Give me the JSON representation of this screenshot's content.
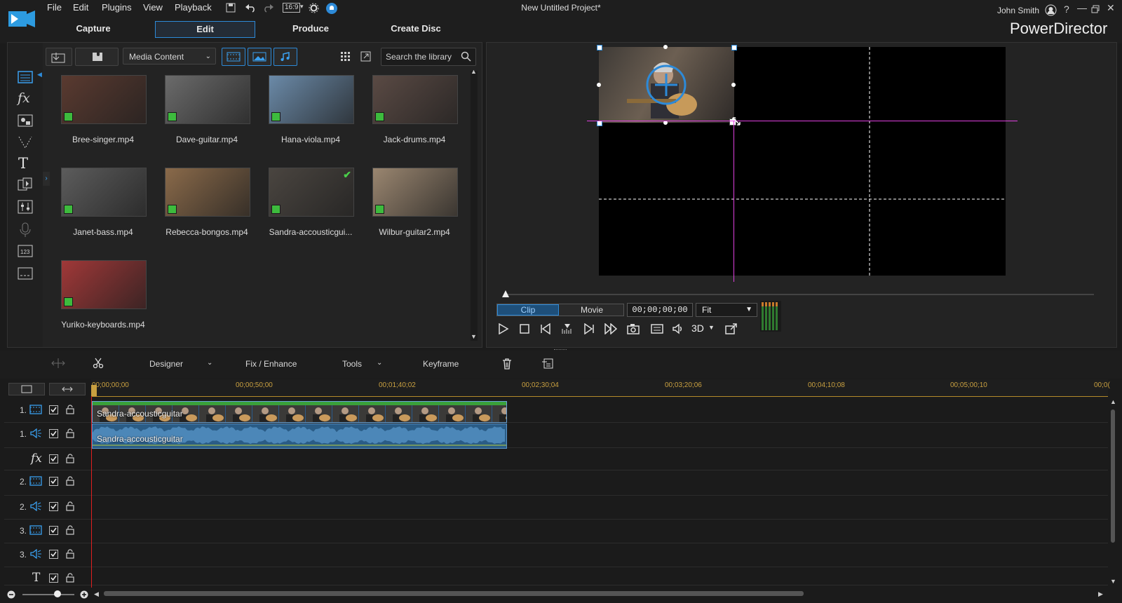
{
  "app": {
    "name": "PowerDirector",
    "project_title": "New Untitled Project*",
    "user": "John Smith",
    "aspect": "16:9"
  },
  "menu": [
    "File",
    "Edit",
    "Plugins",
    "View",
    "Playback"
  ],
  "mode_tabs": [
    "Capture",
    "Edit",
    "Produce",
    "Create Disc"
  ],
  "library": {
    "dropdown": "Media Content",
    "search_placeholder": "Search the library",
    "items": [
      {
        "name": "Bree-singer.mp4",
        "tone": "#5a3a30",
        "checked": false
      },
      {
        "name": "Dave-guitar.mp4",
        "tone": "#6b6b6b",
        "checked": false
      },
      {
        "name": "Hana-viola.mp4",
        "tone": "#6b8aa8",
        "checked": false
      },
      {
        "name": "Jack-drums.mp4",
        "tone": "#5a4a44",
        "checked": false
      },
      {
        "name": "Janet-bass.mp4",
        "tone": "#5c5c5c",
        "checked": false
      },
      {
        "name": "Rebecca-bongos.mp4",
        "tone": "#8a6a4a",
        "checked": false
      },
      {
        "name": "Sandra-accousticgui...",
        "tone": "#4a4540",
        "checked": true
      },
      {
        "name": "Wilbur-guitar2.mp4",
        "tone": "#9a8670",
        "checked": false
      },
      {
        "name": "Yuriko-keyboards.mp4",
        "tone": "#a03838",
        "checked": false
      }
    ]
  },
  "preview": {
    "clip_tab": "Clip",
    "movie_tab": "Movie",
    "timecode": "00;00;00;00",
    "fit": "Fit",
    "mode_3d": "3D"
  },
  "timeline_toolbar": {
    "designer": "Designer",
    "fix_enhance": "Fix / Enhance",
    "tools": "Tools",
    "keyframe": "Keyframe"
  },
  "ruler": [
    "00;00;00;00",
    "00;00;50;00",
    "00;01;40;02",
    "00;02;30;04",
    "00;03;20;06",
    "00;04;10;08",
    "00;05;00;10",
    "00;0("
  ],
  "tracks": [
    {
      "num": "1.",
      "kind": "video"
    },
    {
      "num": "1.",
      "kind": "audio"
    },
    {
      "num": "",
      "kind": "fx"
    },
    {
      "num": "2.",
      "kind": "video"
    },
    {
      "num": "2.",
      "kind": "audio"
    },
    {
      "num": "3.",
      "kind": "video"
    },
    {
      "num": "3.",
      "kind": "audio"
    },
    {
      "num": "",
      "kind": "title"
    }
  ],
  "clip": {
    "video_label": "Sandra-accousticguitar",
    "audio_label": "Sandra-accousticguitar"
  },
  "colors": {
    "accent": "#2d8ad8",
    "guide": "#e040e0",
    "timecode": "#c9a040",
    "playhead": "#e02020"
  }
}
